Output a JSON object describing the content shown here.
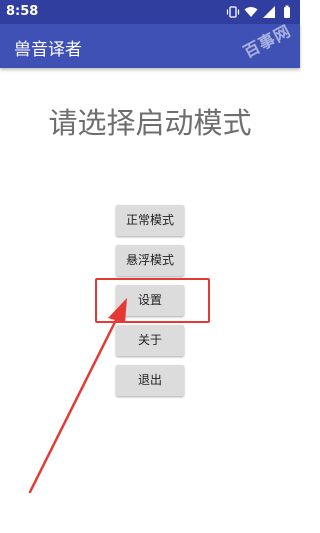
{
  "status_bar": {
    "time": "8:58",
    "icons": [
      "vibrate-icon",
      "wifi-icon",
      "signal-icon",
      "battery-icon"
    ]
  },
  "app_bar": {
    "title": "兽音译者",
    "watermark": "百事网"
  },
  "main": {
    "heading": "请选择启动模式",
    "buttons": [
      {
        "label": "正常模式"
      },
      {
        "label": "悬浮模式"
      },
      {
        "label": "设置"
      },
      {
        "label": "关于"
      },
      {
        "label": "退出"
      }
    ]
  },
  "colors": {
    "status_bar": "#303f9f",
    "app_bar": "#3f51b5",
    "annotation": "#e53935"
  }
}
